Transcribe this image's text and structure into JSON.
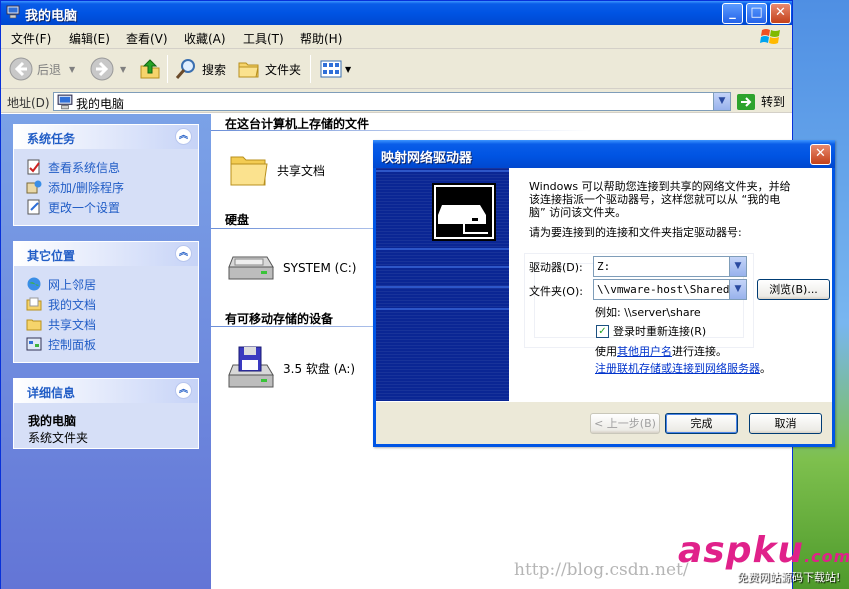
{
  "window": {
    "title": "我的电脑",
    "buttons": {
      "minimize": "_",
      "maximize": "□",
      "close": "✕"
    }
  },
  "menu": [
    "文件(F)",
    "编辑(E)",
    "查看(V)",
    "收藏(A)",
    "工具(T)",
    "帮助(H)"
  ],
  "toolbar": {
    "back": "后退",
    "search": "搜索",
    "folders": "文件夹"
  },
  "address": {
    "label": "地址(D)",
    "value": "我的电脑",
    "go": "转到"
  },
  "taskpane": {
    "system_tasks": {
      "title": "系统任务",
      "items": [
        "查看系统信息",
        "添加/删除程序",
        "更改一个设置"
      ]
    },
    "other_places": {
      "title": "其它位置",
      "items": [
        "网上邻居",
        "我的文档",
        "共享文档",
        "控制面板"
      ]
    },
    "details": {
      "title": "详细信息",
      "name": "我的电脑",
      "desc": "系统文件夹"
    }
  },
  "content": {
    "group_stored": "在这台计算机上存储的文件",
    "shared_docs": "共享文档",
    "group_hdd": "硬盘",
    "system_drive": "SYSTEM (C:)",
    "group_removable": "有可移动存储的设备",
    "floppy": "3.5 软盘 (A:)"
  },
  "dialog": {
    "title": "映射网络驱动器",
    "intro": [
      "Windows 可以帮助您连接到共享的网络文件夹，并给",
      "该连接指派一个驱动器号，这样您就可以从 “我的电",
      "脑” 访问该文件夹。"
    ],
    "prompt": "请为要连接到的连接和文件夹指定驱动器号:",
    "drive_label": "驱动器(D):",
    "drive_value": "Z:",
    "folder_label": "文件夹(O):",
    "folder_value": "\\\\vmware-host\\Shared F",
    "browse": "浏览(B)...",
    "example": "例如: \\\\server\\share",
    "reconnect": "登录时重新连接(R)",
    "reconnect_checked": true,
    "use_other_prefix": "使用",
    "use_other_link": "其他用户名",
    "use_other_suffix": "进行连接。",
    "register_link": "注册联机存储或连接到网络服务器",
    "register_suffix": "。",
    "back_btn": "< 上一步(B)",
    "finish_btn": "完成",
    "cancel_btn": "取消"
  },
  "watermark": "http://blog.csdn.net/",
  "brand": {
    "main": "aspku",
    "tld": ".com",
    "sub": "免费网站源码下载站!"
  },
  "colors": {
    "xp_blue": "#0054e3",
    "task_link": "#215dc6",
    "dialog_art": "#0a2694"
  }
}
